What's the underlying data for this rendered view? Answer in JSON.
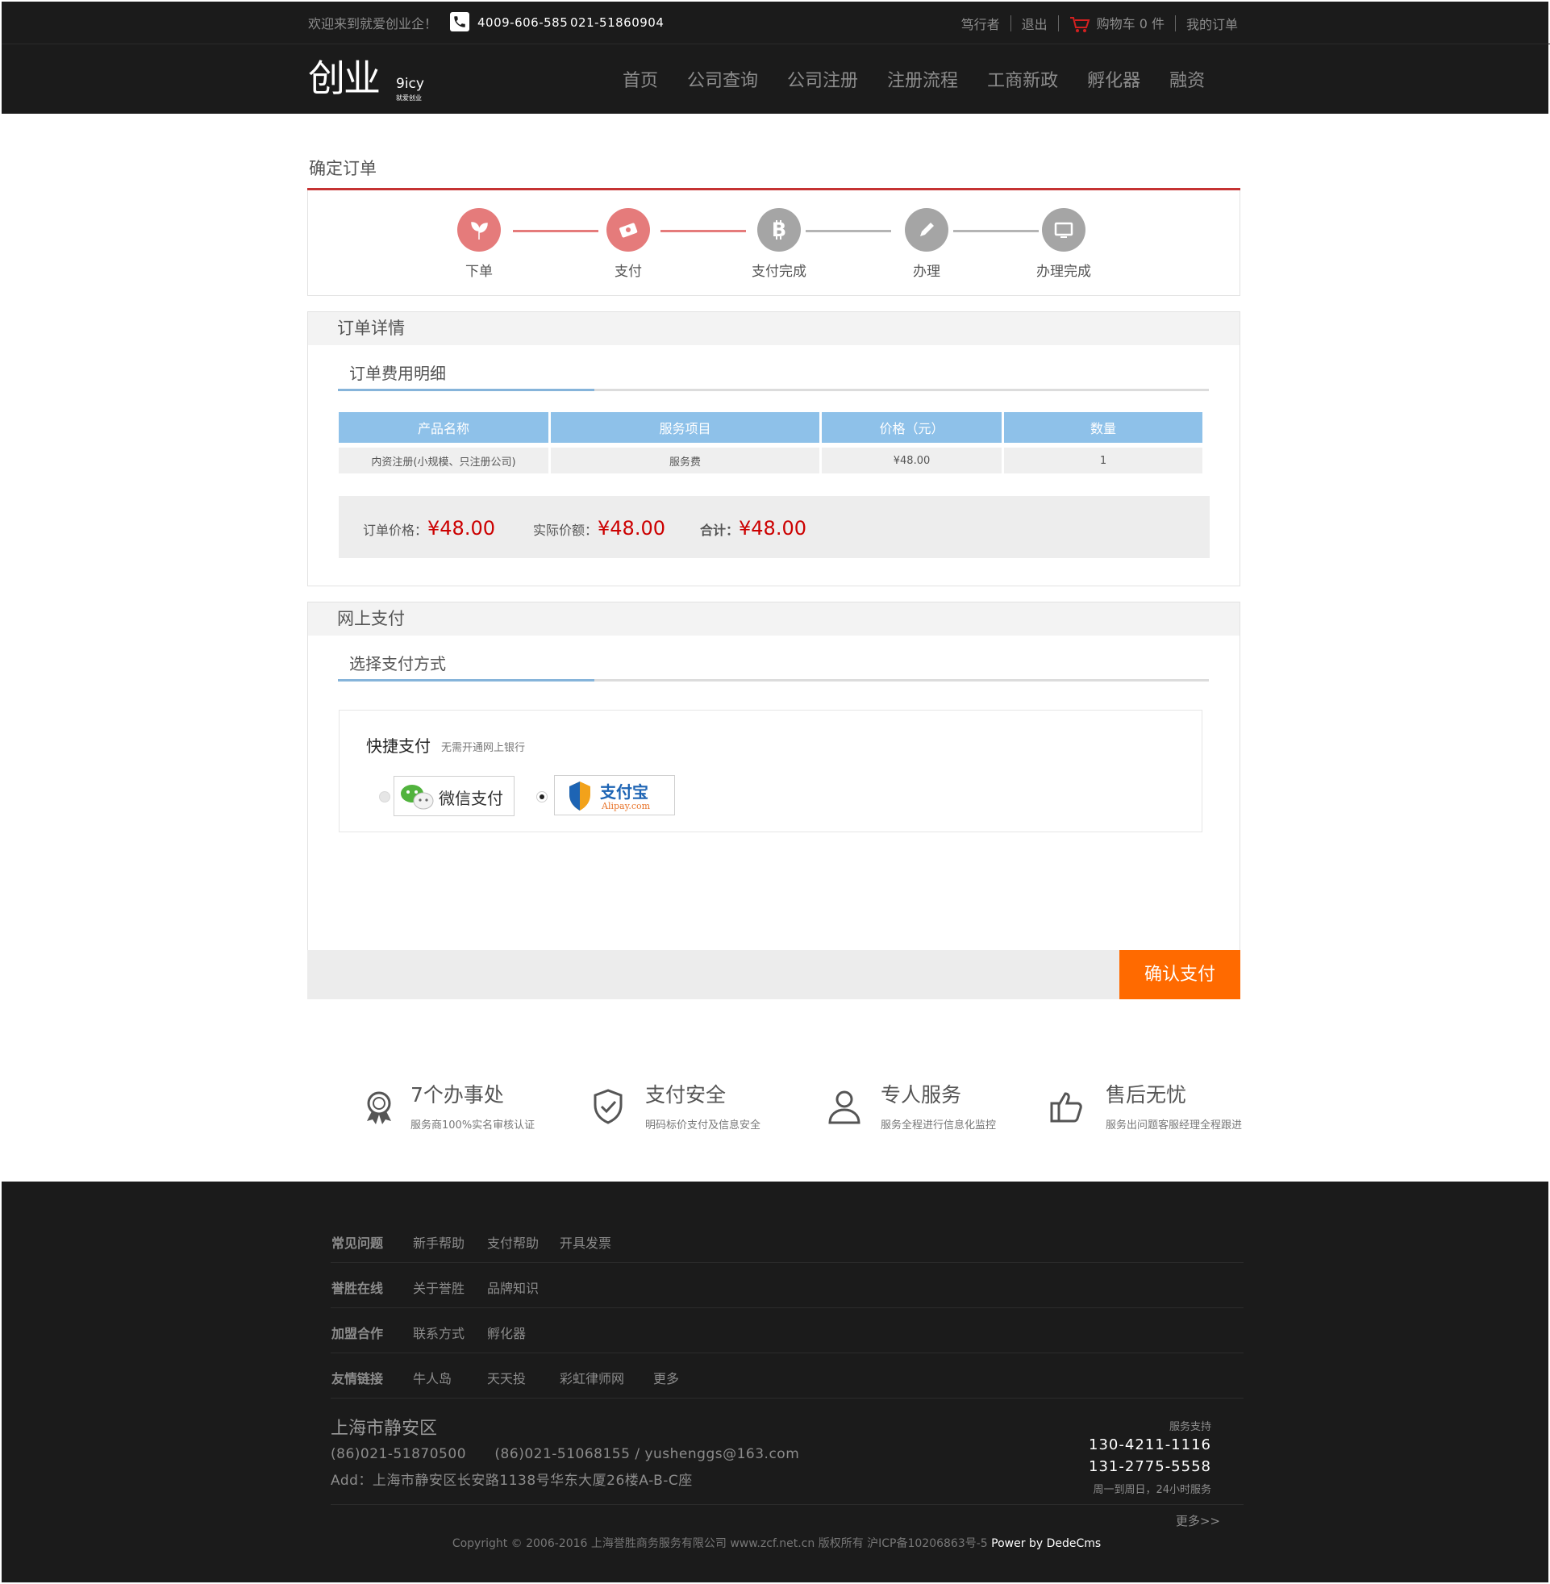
{
  "header": {
    "welcome": "欢迎来到就爱创业企！",
    "phone1": "4009-606-585",
    "phone2": "021-51860904",
    "links": {
      "user": "笃行者",
      "logout": "退出",
      "cart": "购物车 0 件",
      "orders": "我的订单"
    },
    "logo": {
      "main": "创业",
      "sub1": "9icy",
      "sub2": "就爱创业"
    },
    "nav": [
      "首页",
      "公司查询",
      "公司注册",
      "注册流程",
      "工商新政",
      "孵化器",
      "融资"
    ]
  },
  "page": {
    "title": "确定订单",
    "steps": [
      {
        "label": "下单",
        "icon": "leaf-icon",
        "status": "done"
      },
      {
        "label": "支付",
        "icon": "banknote-icon",
        "status": "done"
      },
      {
        "label": "支付完成",
        "icon": "bitcoin-icon",
        "status": "todo"
      },
      {
        "label": "办理",
        "icon": "pencil-icon",
        "status": "todo"
      },
      {
        "label": "办理完成",
        "icon": "monitor-icon",
        "status": "todo"
      }
    ]
  },
  "order": {
    "section_title": "订单详情",
    "sub_title": "订单费用明细",
    "columns": [
      "产品名称",
      "服务项目",
      "价格（元）",
      "数量"
    ],
    "rows": [
      [
        "内资注册(小规模、只注册公司)",
        "服务费",
        "¥48.00",
        "1"
      ]
    ],
    "order_price_label": "订单价格：",
    "order_price": "¥48.00",
    "actual_label": "实际价额：",
    "actual": "¥48.00",
    "total_label": "合计：",
    "total": "¥48.00"
  },
  "payment": {
    "section_title": "网上支付",
    "sub_title": "选择支付方式",
    "quick_title": "快捷支付",
    "quick_note": "无需开通网上银行",
    "options": [
      {
        "name": "微信支付",
        "selected": false
      },
      {
        "name": "支付宝",
        "sub": "Alipay.com",
        "selected": true
      }
    ],
    "confirm": "确认支付"
  },
  "features": [
    {
      "title": "7个办事处",
      "sub": "服务商100%实名审核认证",
      "icon": "badge-icon"
    },
    {
      "title": "支付安全",
      "sub": "明码标价支付及信息安全",
      "icon": "shield-check-icon"
    },
    {
      "title": "专人服务",
      "sub": "服务全程进行信息化监控",
      "icon": "user-icon"
    },
    {
      "title": "售后无忧",
      "sub": "服务出问题客服经理全程跟进",
      "icon": "thumbs-up-icon"
    }
  ],
  "footer": {
    "rows": [
      {
        "head": "常见问题",
        "links": [
          "新手帮助",
          "支付帮助",
          "开具发票"
        ]
      },
      {
        "head": "誉胜在线",
        "links": [
          "关于誉胜",
          "品牌知识"
        ]
      },
      {
        "head": "加盟合作",
        "links": [
          "联系方式",
          "孵化器"
        ]
      },
      {
        "head": "友情链接",
        "links": [
          "牛人岛",
          "天天投",
          "彩虹律师网",
          "更多"
        ]
      }
    ],
    "city": "上海市静安区",
    "contact": "(86)021-51870500      (86)021-51068155 / yushenggs@163.com",
    "address": "Add：上海市静安区长安路1138号华东大厦26楼A-B-C座",
    "service_label": "服务支持",
    "tel1": "130-4211-1116",
    "tel2": "131-2775-5558",
    "service_time": "周一到周日，24小时服务",
    "more": "更多>>",
    "copyright": "Copyright © 2006-2016 上海誉胜商务服务有限公司 www.zcf.net.cn  版权所有  沪ICP备10206863号-5",
    "power": "Power by DedeCms"
  },
  "colors": {
    "accent_red": "#c53232",
    "step_done": "#e57b7b",
    "table_head": "#8ec1e9",
    "price": "#cc0000",
    "confirm": "#ff6a00"
  }
}
